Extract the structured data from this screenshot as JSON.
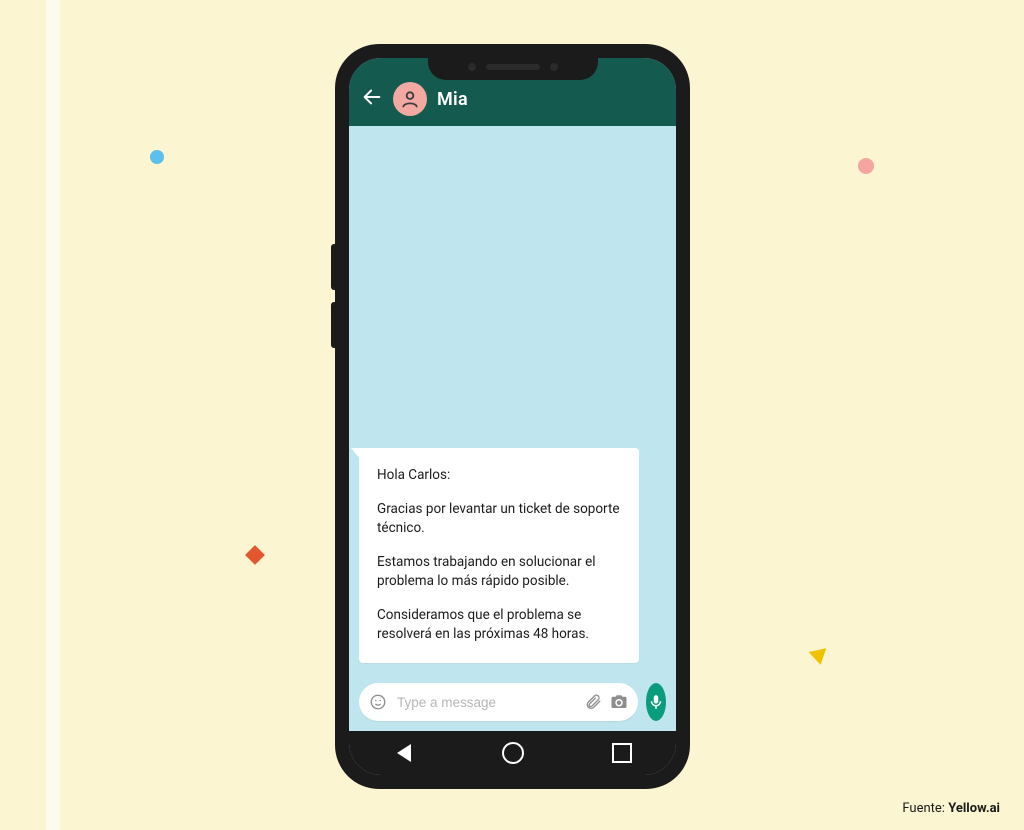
{
  "header": {
    "contact_name": "Mia"
  },
  "message": {
    "greeting": "Hola Carlos:",
    "line1": "Gracias por levantar un ticket de soporte técnico.",
    "line2": "Estamos trabajando en solucionar el problema lo más rápido posible.",
    "line3": "Consideramos que el problema se resolverá en las próximas 48 horas."
  },
  "composer": {
    "placeholder": "Type a message"
  },
  "attribution": {
    "prefix": "Fuente: ",
    "source": "Yellow.ai"
  }
}
